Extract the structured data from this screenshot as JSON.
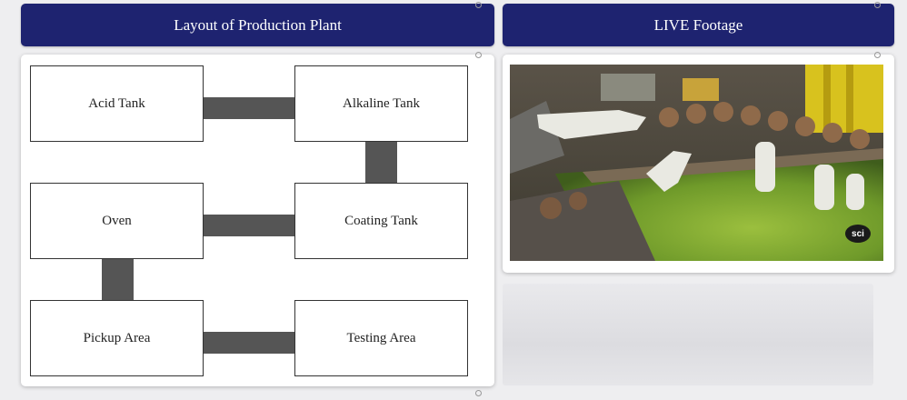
{
  "header_left": {
    "title": "Layout of Production Plant"
  },
  "header_right": {
    "title": "LIVE Footage"
  },
  "layout": {
    "stations": {
      "acid_tank": "Acid Tank",
      "alkaline_tank": "Alkaline Tank",
      "oven": "Oven",
      "coating_tank": "Coating Tank",
      "pickup_area": "Pickup Area",
      "testing_area": "Testing Area"
    }
  },
  "video": {
    "watermark": "sci"
  }
}
